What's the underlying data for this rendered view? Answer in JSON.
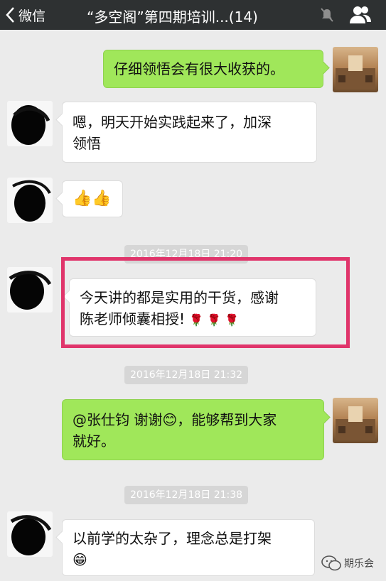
{
  "header": {
    "back_label": "微信",
    "title": "“多空阁”第四期培训...(14)"
  },
  "messages": [
    {
      "text": "仔细领悟会有很大收获的。"
    },
    {
      "line1": "嗯，明天开始实践起来了，加深",
      "line2": "领悟"
    },
    {
      "emoji": "👍👍"
    },
    {
      "time": "2016年12月18日 21:20"
    },
    {
      "line1": "今天讲的都是实用的干货，感谢",
      "line2": "陈老师倾囊相授!",
      "roses": "🌹 🌹 🌹"
    },
    {
      "time": "2016年12月18日 21:32"
    },
    {
      "line1": "@张仕钧 谢谢😊，能够帮到大家",
      "line2": "就好。"
    },
    {
      "time": "2016年12月18日 21:38"
    },
    {
      "line1": "以前学的太杂了，理念总是打架",
      "line2": "😁"
    }
  ],
  "watermark": {
    "text": "期乐会"
  },
  "colors": {
    "highlight": "#e0356b",
    "sent_bubble": "#a0e75a",
    "topbar": "#2e3132"
  }
}
